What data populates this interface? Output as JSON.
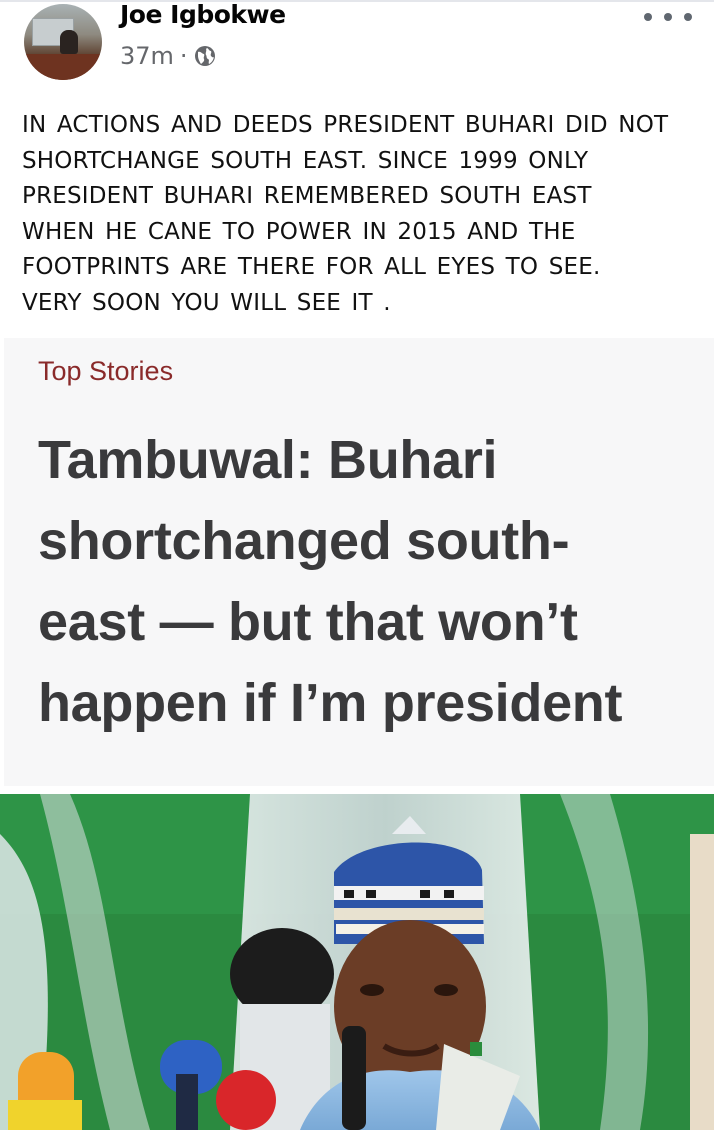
{
  "post": {
    "author": "Joe Igbokwe",
    "time": "37m",
    "separator": "·",
    "audience_icon": "globe-icon",
    "more_icon": "more-options-icon",
    "text_lines": [
      "IN ACTIONS AND DEEDS PRESIDENT BUHARI DID NOT",
      "SHORTCHANGE SOUTH EAST. SINCE 1999 ONLY",
      "PRESIDENT BUHARI REMEMBERED SOUTH EAST",
      "WHEN HE CANE TO POWER IN 2015 AND THE",
      "FOOTPRINTS ARE THERE FOR ALL EYES TO SEE.",
      "VERY SOON YOU WILL SEE IT ."
    ]
  },
  "article": {
    "kicker": "Top Stories",
    "headline_lines": [
      "Tambuwal: Buhari",
      "shortchanged south-",
      "east — but that won’t",
      "happen if I’m president"
    ]
  },
  "colors": {
    "kicker": "#8a2a2a",
    "headline": "#3a3a3c",
    "meta": "#65676b"
  }
}
